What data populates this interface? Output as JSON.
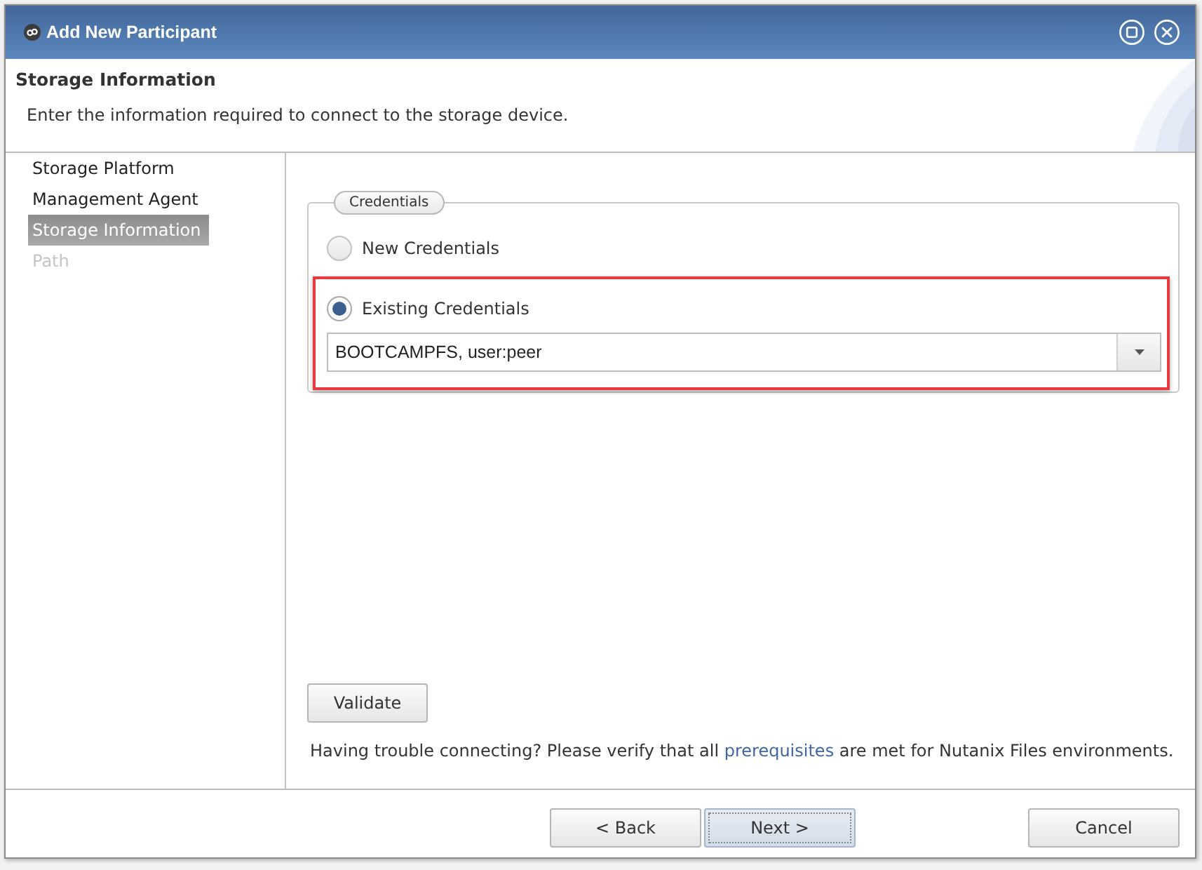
{
  "window": {
    "title": "Add New Participant"
  },
  "header": {
    "title": "Storage Information",
    "subtitle": "Enter the information required to connect to the storage device."
  },
  "steps": [
    {
      "label": "Storage Platform",
      "selected": false,
      "disabled": false
    },
    {
      "label": "Management Agent",
      "selected": false,
      "disabled": false
    },
    {
      "label": "Storage Information",
      "selected": true,
      "disabled": false
    },
    {
      "label": "Path",
      "selected": false,
      "disabled": true
    }
  ],
  "credentials": {
    "legend": "Credentials",
    "options": [
      {
        "label": "New Credentials",
        "selected": false,
        "highlighted": false
      },
      {
        "label": "Existing Credentials",
        "selected": true,
        "highlighted": true,
        "dropdown": {
          "value": "BOOTCAMPFS, user:peer"
        }
      }
    ]
  },
  "validate_button": "Validate",
  "help": {
    "before": "Having trouble connecting? Please verify that all ",
    "link": "prerequisites",
    "after": " are met for Nutanix Files environments."
  },
  "buttons": [
    {
      "label": "< Back",
      "focused": false
    },
    {
      "label": "Next >",
      "focused": true
    },
    {
      "label": "Cancel",
      "focused": false
    }
  ]
}
